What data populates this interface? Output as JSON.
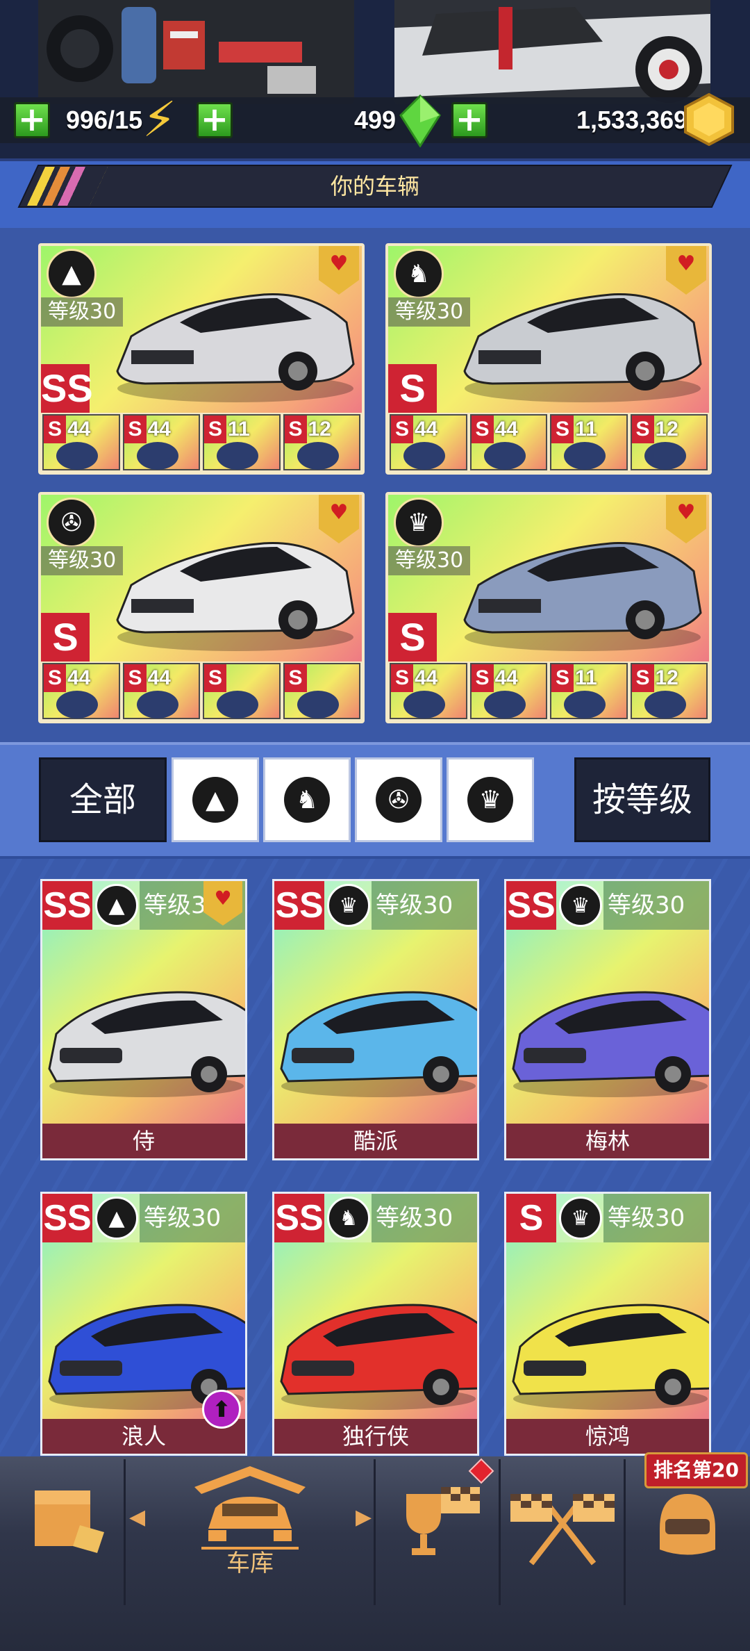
{
  "resources": {
    "energy": "996/15",
    "gems": "499",
    "coins": "1,533,369",
    "energy_icon": "lightning-icon",
    "gem_icon": "gem-icon",
    "coin_icon": "coin-icon"
  },
  "section_title": "你的车辆",
  "favorites": [
    {
      "class_icon": "road-icon",
      "level": "等级30",
      "rank": "SS",
      "parts": [
        {
          "r": "S",
          "v": "44"
        },
        {
          "r": "S",
          "v": "44"
        },
        {
          "r": "S",
          "v": "11"
        },
        {
          "r": "S",
          "v": "12"
        }
      ]
    },
    {
      "class_icon": "horse-icon",
      "level": "等级30",
      "rank": "S",
      "parts": [
        {
          "r": "S",
          "v": "44"
        },
        {
          "r": "S",
          "v": "44"
        },
        {
          "r": "S",
          "v": "11"
        },
        {
          "r": "S",
          "v": "12"
        }
      ]
    },
    {
      "class_icon": "wheel-icon",
      "level": "等级30",
      "rank": "S",
      "parts": [
        {
          "r": "S",
          "v": "44"
        },
        {
          "r": "S",
          "v": "44"
        },
        {
          "r": "S",
          "v": ""
        },
        {
          "r": "S",
          "v": ""
        }
      ]
    },
    {
      "class_icon": "crown-icon",
      "level": "等级30",
      "rank": "S",
      "parts": [
        {
          "r": "S",
          "v": "44"
        },
        {
          "r": "S",
          "v": "44"
        },
        {
          "r": "S",
          "v": "11"
        },
        {
          "r": "S",
          "v": "12"
        }
      ]
    }
  ],
  "filters": {
    "all": "全部",
    "sort": "按等级",
    "icons": [
      "road-icon",
      "horse-icon",
      "wheel-icon",
      "crown-icon"
    ]
  },
  "garage": [
    {
      "rank": "SS",
      "class_icon": "road-icon",
      "level": "等级30",
      "name": "侍"
    },
    {
      "rank": "SS",
      "class_icon": "crown-icon",
      "level": "等级30",
      "name": "酷派"
    },
    {
      "rank": "SS",
      "class_icon": "crown-icon",
      "level": "等级30",
      "name": "梅林"
    },
    {
      "rank": "SS",
      "class_icon": "road-icon",
      "level": "等级30",
      "name": "浪人"
    },
    {
      "rank": "SS",
      "class_icon": "horse-icon",
      "level": "等级30",
      "name": "独行侠"
    },
    {
      "rank": "S",
      "class_icon": "crown-icon",
      "level": "等级30",
      "name": "惊鸿"
    }
  ],
  "nav": {
    "garage_label": "车库",
    "rank_badge": "排名第20"
  },
  "colors": {
    "accent": "#e8b73a",
    "rank_red": "#cf2333",
    "plus_green": "#3fbf2a"
  }
}
